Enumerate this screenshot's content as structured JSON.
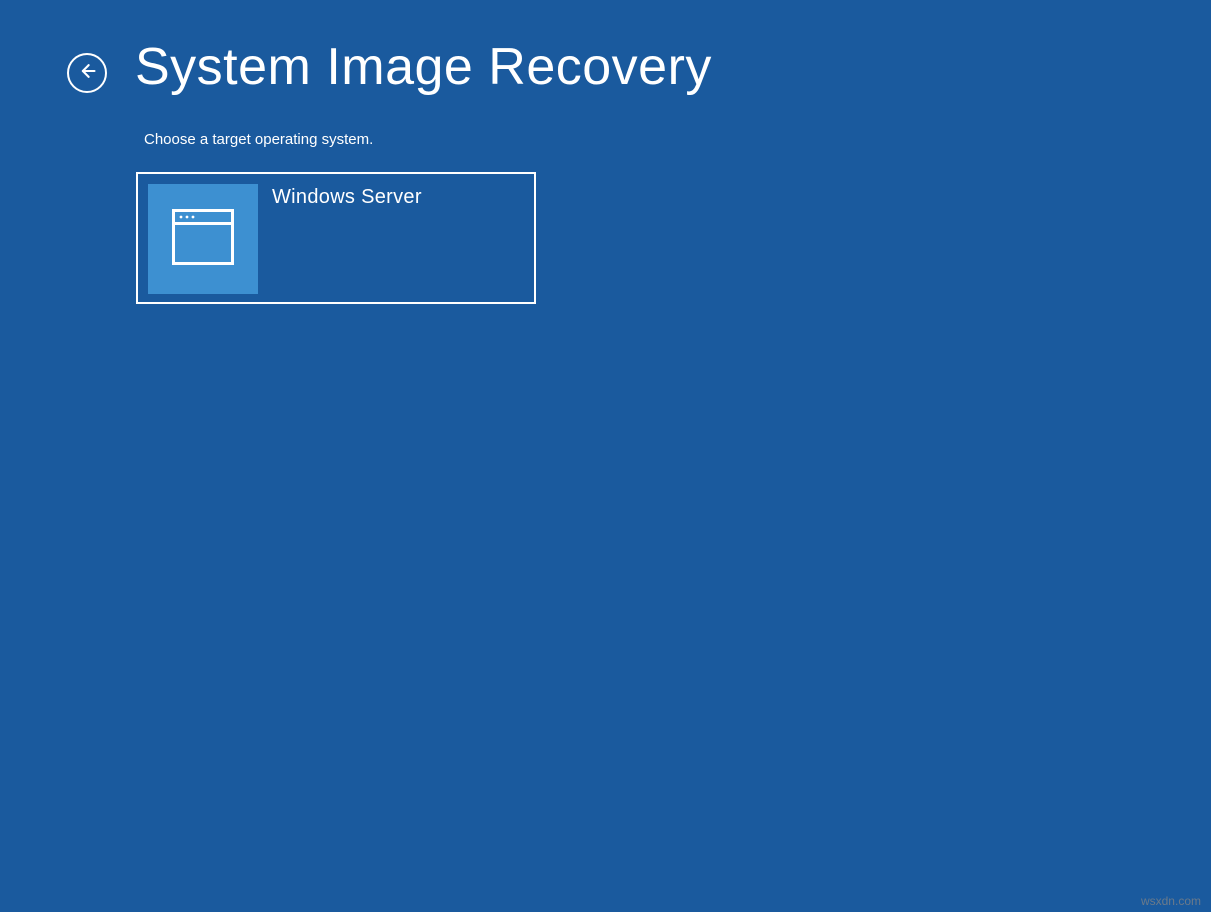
{
  "header": {
    "title": "System Image Recovery"
  },
  "instruction": "Choose a target operating system.",
  "os_options": [
    {
      "label": "Windows Server"
    }
  ],
  "watermark": "wsxdn.com"
}
